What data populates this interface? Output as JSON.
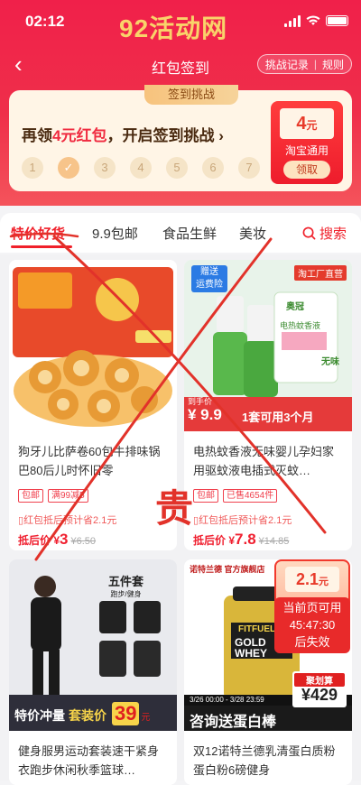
{
  "status_bar": {
    "time": "02:12",
    "site_title": "92活动网"
  },
  "nav": {
    "title": "红包签到",
    "challenge_record": "挑战记录",
    "separator": "|",
    "rules": "规则"
  },
  "signin_card": {
    "tag": "签到挑战",
    "headline_prefix": "再领",
    "headline_amount": "4元红包",
    "headline_suffix": "，开启签到挑战 ›",
    "steps": [
      "1",
      "✓",
      "3",
      "4",
      "5",
      "6",
      "7"
    ],
    "coupon": {
      "amount": "4",
      "unit": "元",
      "scope": "淘宝通用",
      "button": "领取"
    }
  },
  "tabs": [
    "特价好货",
    "9.9包邮",
    "食品生鲜",
    "美妆"
  ],
  "search_label": "搜索",
  "products": [
    {
      "title": "狗牙儿比萨卷60包牛排味锅巴80后儿时怀旧零",
      "badges": [
        "包邮",
        "满99减5"
      ],
      "save_text": "红包抵后预计省2.1元",
      "price_prefix": "抵后价 ",
      "price_symbol": "¥",
      "price": "3",
      "orig_price": "¥6.50"
    },
    {
      "title": "电热蚊香液无味婴儿孕妇家用驱蚊液电插式灭蚊…",
      "badges": [
        "包邮",
        "已售4654件"
      ],
      "save_text": "红包抵后预计省2.1元",
      "price_prefix": "抵后价 ",
      "price_symbol": "¥",
      "price": "7.8",
      "orig_price": "¥14.85",
      "image_text": {
        "gift": "赠送",
        "gift_sub": "运费险",
        "store": "淘工厂直营",
        "hand_price": "到手价",
        "hand_value": "¥ 9.9",
        "banner": "1套可用3个月",
        "brand": "奥冠",
        "liquid": "电热蚊香液",
        "tasteless": "无味"
      }
    },
    {
      "title": "健身服男运动套装速干紧身衣跑步休闲秋季篮球…",
      "image_text": {
        "set": "五件套",
        "set_sub": "跑步/健身",
        "promo": "特价冲量",
        "promo_2": "套装价",
        "promo_price": "39",
        "promo_unit": "元"
      }
    },
    {
      "title": "双12诺特兰德乳清蛋白质粉蛋白粉6磅健身",
      "image_text": {
        "store": "诺特兰德 官方旗舰店",
        "deal": "聚划算",
        "deal_price": "¥429",
        "gift": "咨询送蛋白棒",
        "brand": "FITFUEL",
        "product": "GOLD WHEY",
        "dates": "3/26 00:00 - 3/28 23:59",
        "bonus_amount": "2.1",
        "bonus_unit": "元",
        "bonus_text": "当前页可用",
        "countdown": "45:47:30",
        "countdown_suffix": "后失效"
      }
    }
  ],
  "watermark": {
    "char": "贵"
  },
  "colors": {
    "primary_red": "#f0202a",
    "header_red": "#ef2f4a",
    "gold": "#f9d36a",
    "price_red": "#f02030"
  }
}
